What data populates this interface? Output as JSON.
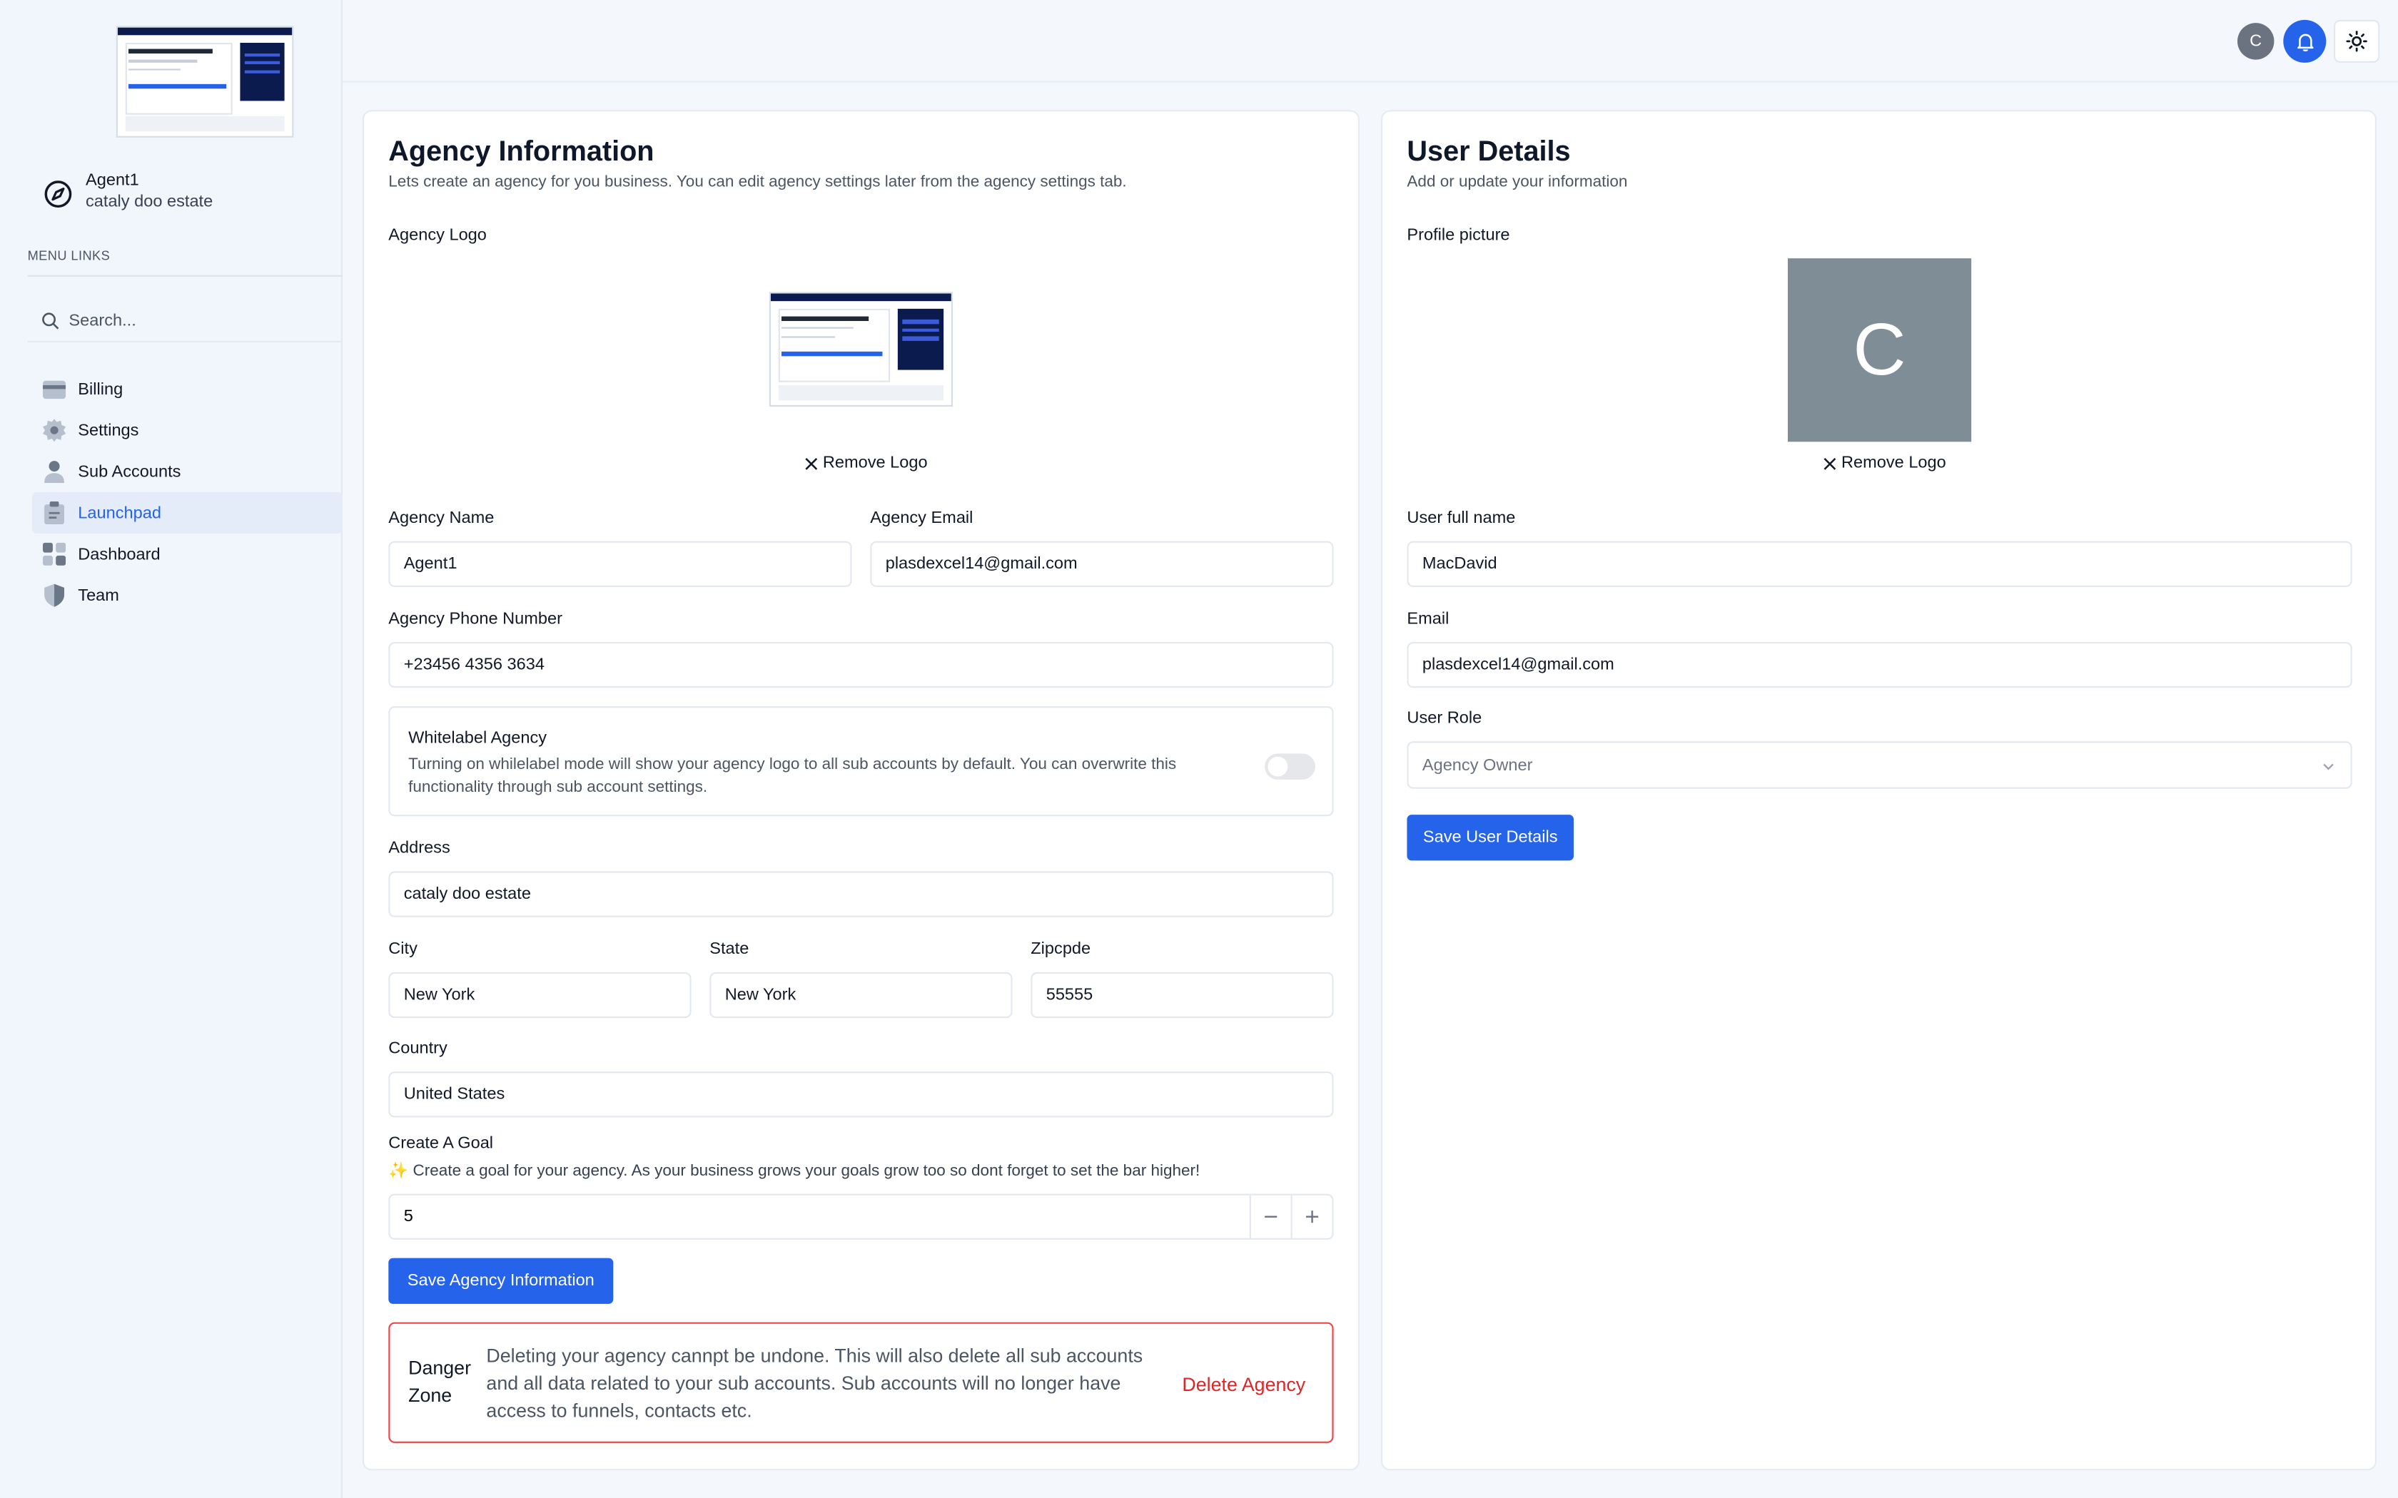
{
  "sidebar": {
    "profile": {
      "name": "Agent1",
      "address": "cataly doo estate"
    },
    "menu_label": "MENU LINKS",
    "search_placeholder": "Search...",
    "items": [
      {
        "label": "Billing",
        "icon": "credit-card-icon"
      },
      {
        "label": "Settings",
        "icon": "gear-icon"
      },
      {
        "label": "Sub Accounts",
        "icon": "person-icon"
      },
      {
        "label": "Launchpad",
        "icon": "clipboard-icon",
        "active": true
      },
      {
        "label": "Dashboard",
        "icon": "grid-icon"
      },
      {
        "label": "Team",
        "icon": "shield-icon"
      }
    ]
  },
  "topbar": {
    "avatar_initial": "C"
  },
  "agency": {
    "title": "Agency Information",
    "subtitle": "Lets create an agency for you business. You can edit agency settings later from the agency settings tab.",
    "logo_label": "Agency Logo",
    "remove_logo": "Remove Logo",
    "name_label": "Agency Name",
    "name_value": "Agent1",
    "email_label": "Agency Email",
    "email_value": "plasdexcel14@gmail.com",
    "phone_label": "Agency Phone Number",
    "phone_value": "+23456 4356 3634",
    "whitelabel_title": "Whitelabel Agency",
    "whitelabel_desc": "Turning on whilelabel mode will show your agency logo to all sub accounts by default. You can overwrite this functionality through sub account settings.",
    "address_label": "Address",
    "address_value": "cataly doo estate",
    "city_label": "City",
    "city_value": "New York",
    "state_label": "State",
    "state_value": "New York",
    "zip_label": "Zipcpde",
    "zip_value": "55555",
    "country_label": "Country",
    "country_value": "United States",
    "goal_label": "Create A Goal",
    "goal_desc": "✨ Create a goal for your agency. As your business grows your goals grow too so dont forget to set the bar higher!",
    "goal_value": "5",
    "save_label": "Save Agency Information",
    "danger_title": "Danger Zone",
    "danger_desc": "Deleting your agency cannpt be undone. This will also delete all sub accounts and all data related to your sub accounts. Sub accounts will no longer have access to funnels, contacts etc.",
    "delete_label": "Delete Agency"
  },
  "user": {
    "title": "User Details",
    "subtitle": "Add or update your information",
    "picture_label": "Profile picture",
    "picture_initial": "C",
    "remove_logo": "Remove Logo",
    "name_label": "User full name",
    "name_value": "MacDavid",
    "email_label": "Email",
    "email_value": "plasdexcel14@gmail.com",
    "role_label": "User Role",
    "role_value": "Agency Owner",
    "save_label": "Save User Details"
  },
  "colors": {
    "accent": "#2563eb",
    "danger": "#dc2626",
    "avatar_bg": "#7f8d97"
  }
}
